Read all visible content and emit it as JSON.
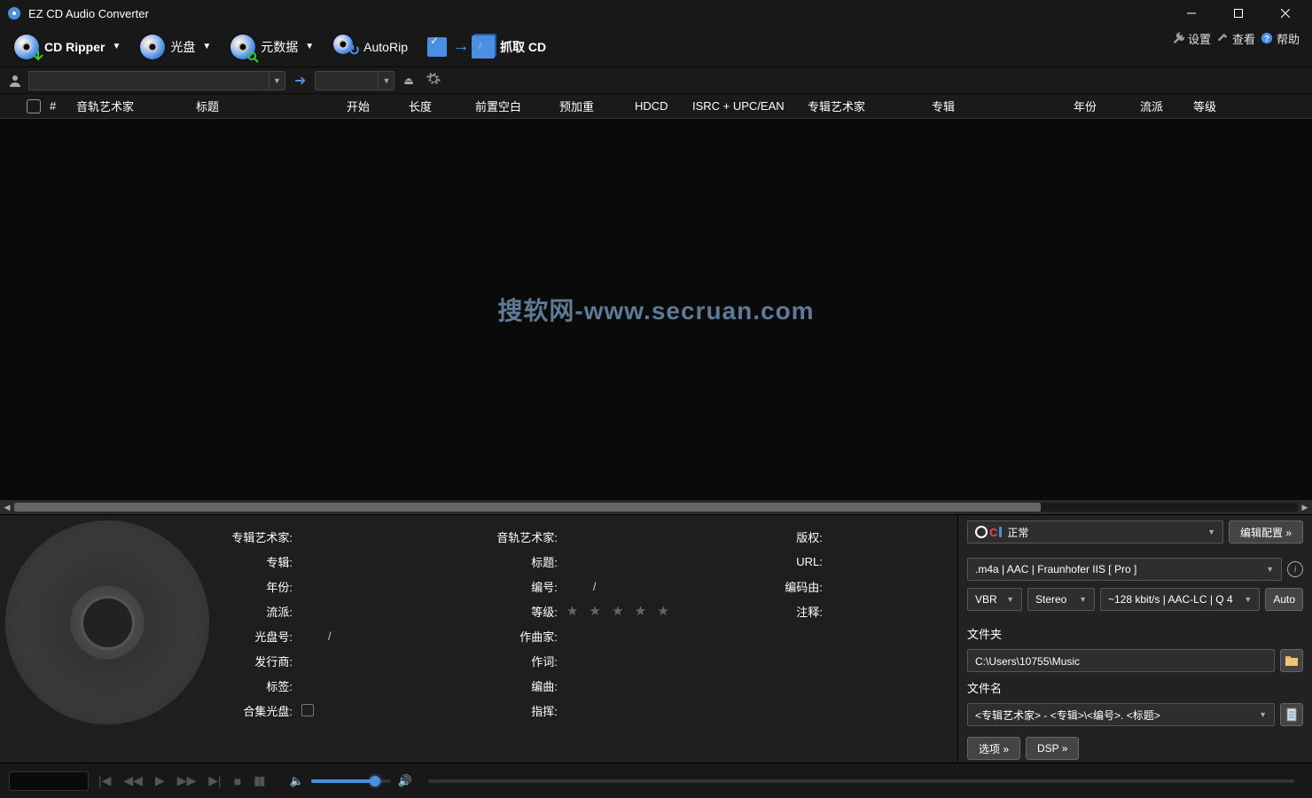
{
  "titlebar": {
    "title": "EZ CD Audio Converter"
  },
  "topmenu": {
    "settings": "设置",
    "view": "查看",
    "help": "帮助"
  },
  "toolbar": {
    "cdripper": "CD Ripper",
    "disc": "光盘",
    "metadata": "元数据",
    "autorip": "AutoRip",
    "ripcd": "抓取 CD"
  },
  "columns": {
    "num": "#",
    "trackartist": "音轨艺术家",
    "title": "标题",
    "start": "开始",
    "length": "长度",
    "pregap": "前置空白",
    "preemph": "预加重",
    "hdcd": "HDCD",
    "isrc": "ISRC + UPC/EAN",
    "albumartist_col": "专辑艺术家",
    "album_col": "专辑",
    "year_col": "年份",
    "genre_col": "流派",
    "rating_col": "等级"
  },
  "watermark": "搜软网-www.secruan.com",
  "meta": {
    "albumartist": "专辑艺术家:",
    "album": "专辑:",
    "year": "年份:",
    "genre": "流派:",
    "discno": "光盘号:",
    "discno_val": "/",
    "publisher": "发行商:",
    "tag": "标签:",
    "compilation": "合集光盘:",
    "trackartist": "音轨艺术家:",
    "title": "标题:",
    "trackno": "编号:",
    "trackno_val": "/",
    "rating": "等级:",
    "composer": "作曲家:",
    "lyricist": "作词:",
    "arranger": "编曲:",
    "conductor": "指挥:",
    "copyright": "版权:",
    "url": "URL:",
    "encodedby": "编码由:",
    "comment": "注释:"
  },
  "right": {
    "profile": "正常",
    "editprofile": "编辑配置 »",
    "format": ".m4a  |  AAC  |  Fraunhofer IIS [ Pro ]",
    "vbr": "VBR",
    "stereo": "Stereo",
    "bitrate": "~128 kbit/s | AAC-LC | Q 4",
    "auto": "Auto",
    "folder_lbl": "文件夹",
    "folder_val": "C:\\Users\\10755\\Music",
    "filename_lbl": "文件名",
    "filename_val": "<专辑艺术家> - <专辑>\\<编号>. <标题>",
    "options": "选项 »",
    "dsp": "DSP »"
  }
}
